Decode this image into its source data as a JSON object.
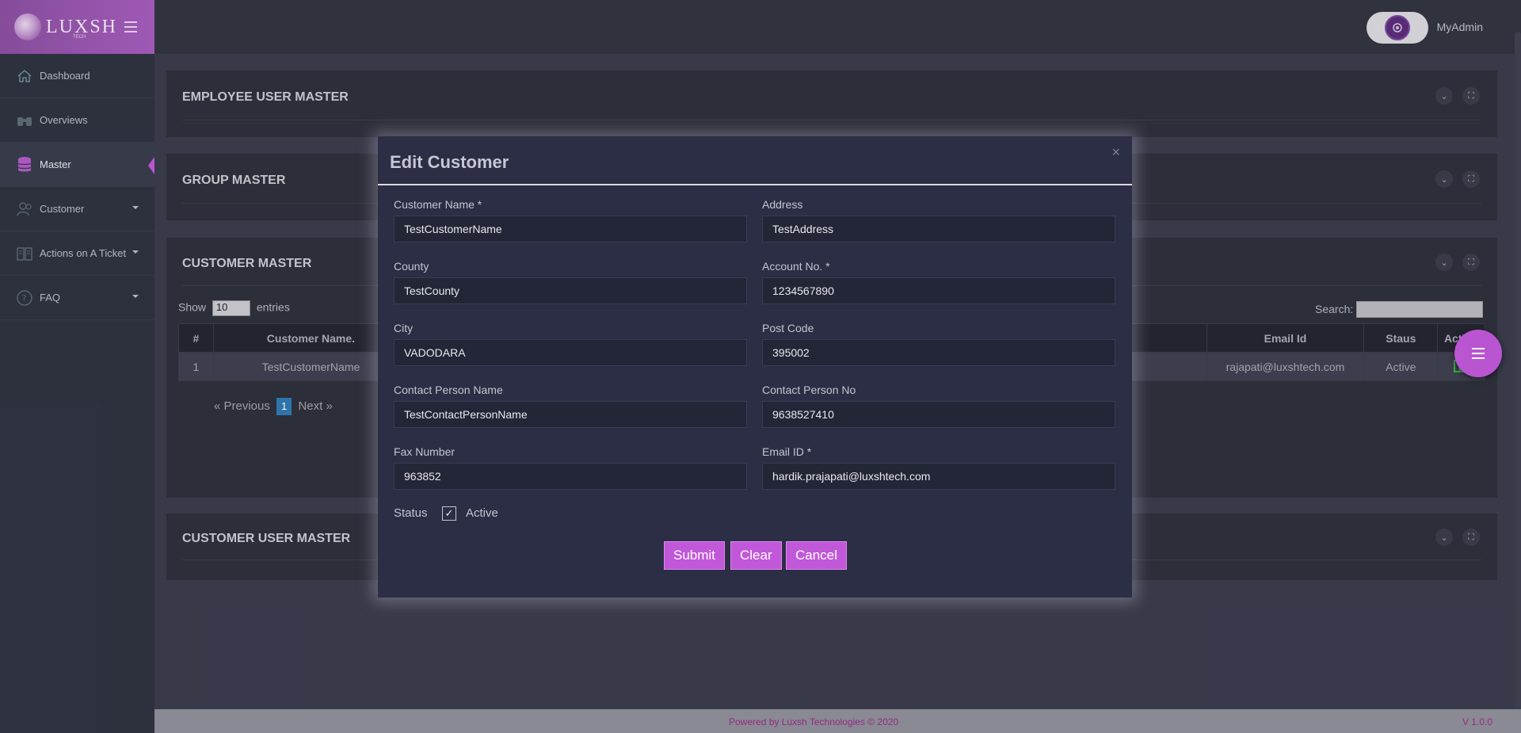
{
  "brand": {
    "logo_text": "LUXSH",
    "logo_sub": "TECH"
  },
  "topbar": {
    "username": "MyAdmin"
  },
  "sidebar": {
    "items": [
      {
        "label": "Dashboard",
        "icon": "home-icon"
      },
      {
        "label": "Overviews",
        "icon": "binoculars-icon"
      },
      {
        "label": "Master",
        "icon": "database-icon"
      },
      {
        "label": "Customer",
        "icon": "users-icon"
      },
      {
        "label": "Actions on A Ticket",
        "icon": "book-icon"
      },
      {
        "label": "FAQ",
        "icon": "question-icon"
      }
    ]
  },
  "panels": {
    "employee": "EMPLOYEE USER MASTER",
    "group": "GROUP MASTER",
    "customer": "CUSTOMER MASTER",
    "customer_user": "CUSTOMER USER MASTER"
  },
  "customer_table": {
    "show_label": "Show",
    "entries_value": "10",
    "entries_label": "entries",
    "search_label": "Search:",
    "columns": [
      "#",
      "Customer Name.",
      "Email Id",
      "Staus",
      "Action"
    ],
    "rows": [
      {
        "num": "1",
        "name": "TestCustomerName",
        "email": "rajapati@luxshtech.com",
        "status": "Active"
      }
    ],
    "pager": {
      "prev": "« Previous",
      "page": "1",
      "next": "Next »"
    }
  },
  "modal": {
    "title": "Edit Customer",
    "close": "×",
    "fields": {
      "customer_name": {
        "label": "Customer Name *",
        "value": "TestCustomerName"
      },
      "address": {
        "label": "Address",
        "value": "TestAddress"
      },
      "county": {
        "label": "County",
        "value": "TestCounty"
      },
      "account_no": {
        "label": "Account No. *",
        "value": "1234567890"
      },
      "city": {
        "label": "City",
        "value": "VADODARA"
      },
      "post_code": {
        "label": "Post Code",
        "value": "395002"
      },
      "contact_name": {
        "label": "Contact Person Name",
        "value": "TestContactPersonName"
      },
      "contact_no": {
        "label": "Contact Person No",
        "value": "9638527410"
      },
      "fax": {
        "label": "Fax Number",
        "value": "963852"
      },
      "email": {
        "label": "Email ID *",
        "value": "hardik.prajapati@luxshtech.com"
      }
    },
    "status_label": "Status",
    "active_label": "Active",
    "active_checked": true,
    "buttons": {
      "submit": "Submit",
      "clear": "Clear",
      "cancel": "Cancel"
    }
  },
  "footer": {
    "powered": "Powered by Luxsh Technologies © 2020",
    "version": "V 1.0.0"
  },
  "colors": {
    "accent": "#c158d9",
    "sidebar": "#2f3341",
    "modal": "#2b2e44"
  }
}
